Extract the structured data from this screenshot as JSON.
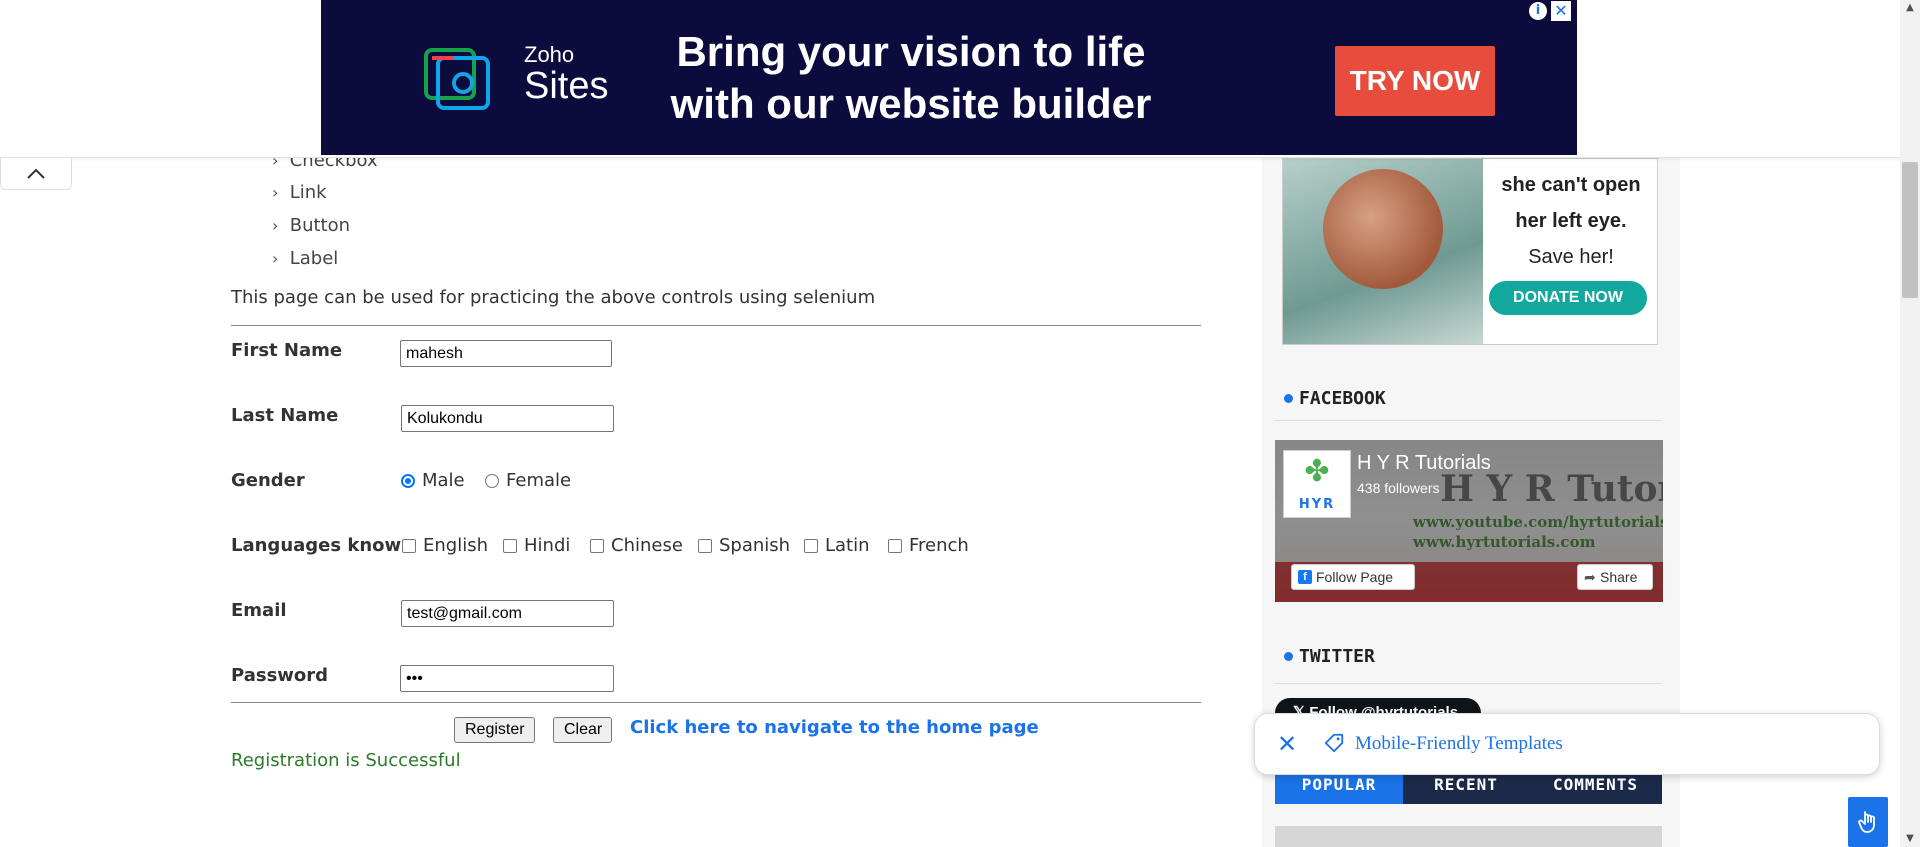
{
  "controls_list": [
    {
      "label": "Checkbox"
    },
    {
      "label": "Link"
    },
    {
      "label": "Button"
    },
    {
      "label": "Label"
    }
  ],
  "intro_text": "This page can be used for practicing the above controls using selenium",
  "form": {
    "first_name": {
      "label": "First Name",
      "value": "mahesh"
    },
    "last_name": {
      "label": "Last Name",
      "value": "Kolukondu"
    },
    "gender": {
      "label": "Gender",
      "options": [
        "Male",
        "Female"
      ],
      "selected": "Male"
    },
    "languages": {
      "label": "Languages known",
      "options": [
        "English",
        "Hindi",
        "Chinese",
        "Spanish",
        "Latin",
        "French"
      ],
      "checked": []
    },
    "email": {
      "label": "Email",
      "value": "test@gmail.com"
    },
    "password": {
      "label": "Password",
      "value": "•••"
    },
    "register_label": "Register",
    "clear_label": "Clear",
    "home_link": "Click here to navigate to the home page",
    "result": "Registration is Successful",
    "result_color": "#2a7a2a"
  },
  "top_ad": {
    "brand_top": "Zoho",
    "brand_bottom": "Sites",
    "headline": "Bring your vision to life with our website builder",
    "cta": "TRY NOW",
    "adchoices_icon": "info-icon",
    "close_icon": "close-icon"
  },
  "sidebar": {
    "charity_ad": {
      "line1": "she can't open",
      "line2": "her left eye.",
      "line3": "Save her!",
      "cta": "DONATE NOW"
    },
    "facebook": {
      "heading": "FACEBOOK",
      "page_name": "H Y R Tutorials",
      "followers": "438 followers",
      "banner_title": "H Y R Tutorials",
      "banner_url1": "www.youtube.com/hyrtutorials",
      "banner_url2": "www.hyrtutorials.com",
      "avatar_text": "HYR",
      "follow_label": "Follow Page",
      "share_label": "Share"
    },
    "twitter": {
      "heading": "TWITTER",
      "follow_label": "Follow @hyrtutorials"
    },
    "tabs": [
      {
        "label": "POPULAR",
        "active": true
      },
      {
        "label": "RECENT",
        "active": false
      },
      {
        "label": "COMMENTS",
        "active": false
      }
    ]
  },
  "floating_chip": {
    "label": "Mobile-Friendly Templates",
    "close_icon": "close-icon",
    "tag_icon": "tag-icon"
  },
  "colors": {
    "accent": "#1a73e8",
    "ad_background": "#0b0b3d",
    "cta_red": "#e74c3c",
    "donate_teal": "#13a89e",
    "tabs_background": "#1b2a49"
  }
}
